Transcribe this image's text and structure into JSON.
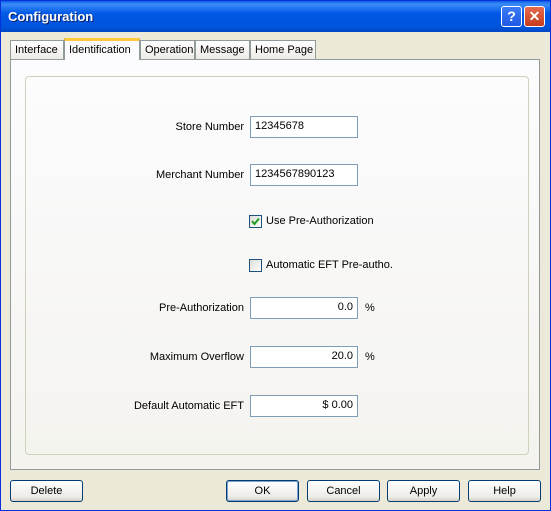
{
  "window": {
    "title": "Configuration"
  },
  "tabs": [
    "Interface",
    "Identification",
    "Operation",
    "Message",
    "Home Page"
  ],
  "fields": {
    "store_number": {
      "label": "Store Number",
      "value": "12345678"
    },
    "merchant_number": {
      "label": "Merchant Number",
      "value": "1234567890123"
    },
    "use_preauth": {
      "label": "Use Pre-Authorization",
      "checked": true
    },
    "auto_eft_preauth": {
      "label": "Automatic EFT Pre-autho.",
      "checked": false
    },
    "preauth": {
      "label": "Pre-Authorization",
      "value": "0.0",
      "unit": "%"
    },
    "max_overflow": {
      "label": "Maximum Overflow",
      "value": "20.0",
      "unit": "%"
    },
    "default_auto_eft": {
      "label": "Default Automatic EFT",
      "value": "$ 0.00"
    }
  },
  "buttons": {
    "delete": "Delete",
    "ok": "OK",
    "cancel": "Cancel",
    "apply": "Apply",
    "help": "Help"
  },
  "titlebar": {
    "help_glyph": "?",
    "close_glyph": "✕"
  }
}
